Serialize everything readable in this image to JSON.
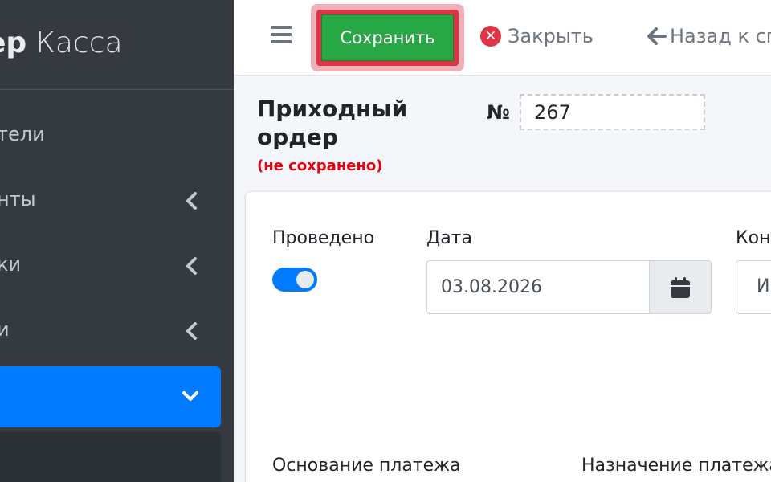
{
  "app": {
    "brand_bold": "ер",
    "brand_light": "Касса"
  },
  "sidebar": {
    "items": [
      {
        "label": "тели",
        "has_chevron": false
      },
      {
        "label": "нты",
        "has_chevron": true,
        "chevron": "chevron-left-icon"
      },
      {
        "label": "ки",
        "has_chevron": true,
        "chevron": "chevron-left-icon"
      },
      {
        "label": "и",
        "has_chevron": true,
        "chevron": "chevron-left-icon"
      },
      {
        "label": "",
        "has_chevron": true,
        "chevron": "chevron-down-icon",
        "active": true
      }
    ]
  },
  "toolbar": {
    "menu_icon": "hamburger-icon",
    "save_label": "Сохранить",
    "close_label": "Закрыть",
    "back_label": "Назад к сп"
  },
  "document": {
    "title": "Приходный ордер",
    "status": "(не сохранено)",
    "number_label": "№",
    "number_value": "267"
  },
  "form": {
    "posted_label": "Проведено",
    "posted": true,
    "date_label": "Дата",
    "date_value": "03.08.2026",
    "counterparty_label": "Конт",
    "counterparty_value": "И",
    "basis_label": "Основание платежа",
    "purpose_label": "Назначение платежа"
  },
  "colors": {
    "sidebar_bg": "#343a40",
    "active_nav": "#007bff",
    "save_green": "#28a745",
    "save_highlight": "#dc3545",
    "unsaved_red": "#e3000f"
  }
}
